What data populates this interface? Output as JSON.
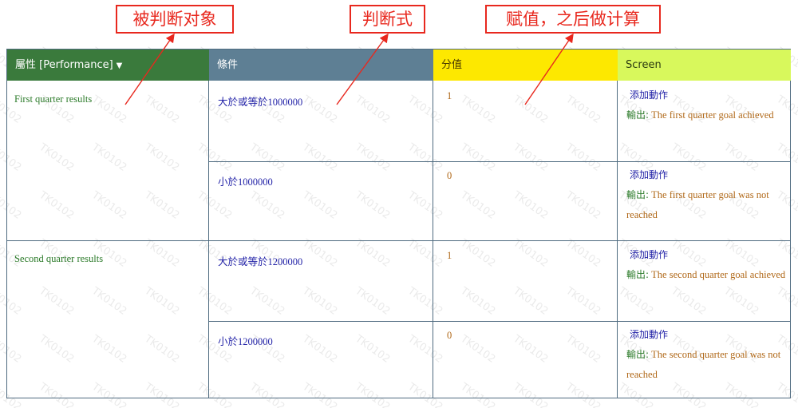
{
  "annotations": {
    "target": "被判断对象",
    "expression": "判断式",
    "assign": "赋值，之后做计算"
  },
  "columns": {
    "attribute": "屬性 [Performance]",
    "condition": "條件",
    "score": "分值",
    "screen": "Screen"
  },
  "groups": [
    {
      "label": "First quarter results",
      "rows": [
        {
          "condition": "大於或等於1000000",
          "score": "1",
          "action": "添加動作",
          "output_label": "輸出:",
          "output": "The first quarter goal achieved"
        },
        {
          "condition": "小於1000000",
          "score": "0",
          "action": "添加動作",
          "output_label": "輸出:",
          "output": "The first quarter goal was not reached"
        }
      ]
    },
    {
      "label": "Second quarter results",
      "rows": [
        {
          "condition": "大於或等於1200000",
          "score": "1",
          "action": "添加動作",
          "output_label": "輸出:",
          "output": "The second quarter goal achieved"
        },
        {
          "condition": "小於1200000",
          "score": "0",
          "action": "添加動作",
          "output_label": "輸出:",
          "output": "The second quarter goal was not reached"
        }
      ]
    }
  ],
  "watermark": "TK0102",
  "colors": {
    "header_attribute": "#3a7a3c",
    "header_condition": "#5e7f94",
    "header_score": "#fde800",
    "header_screen": "#d8f85c",
    "annotation_red": "#e8281e"
  }
}
